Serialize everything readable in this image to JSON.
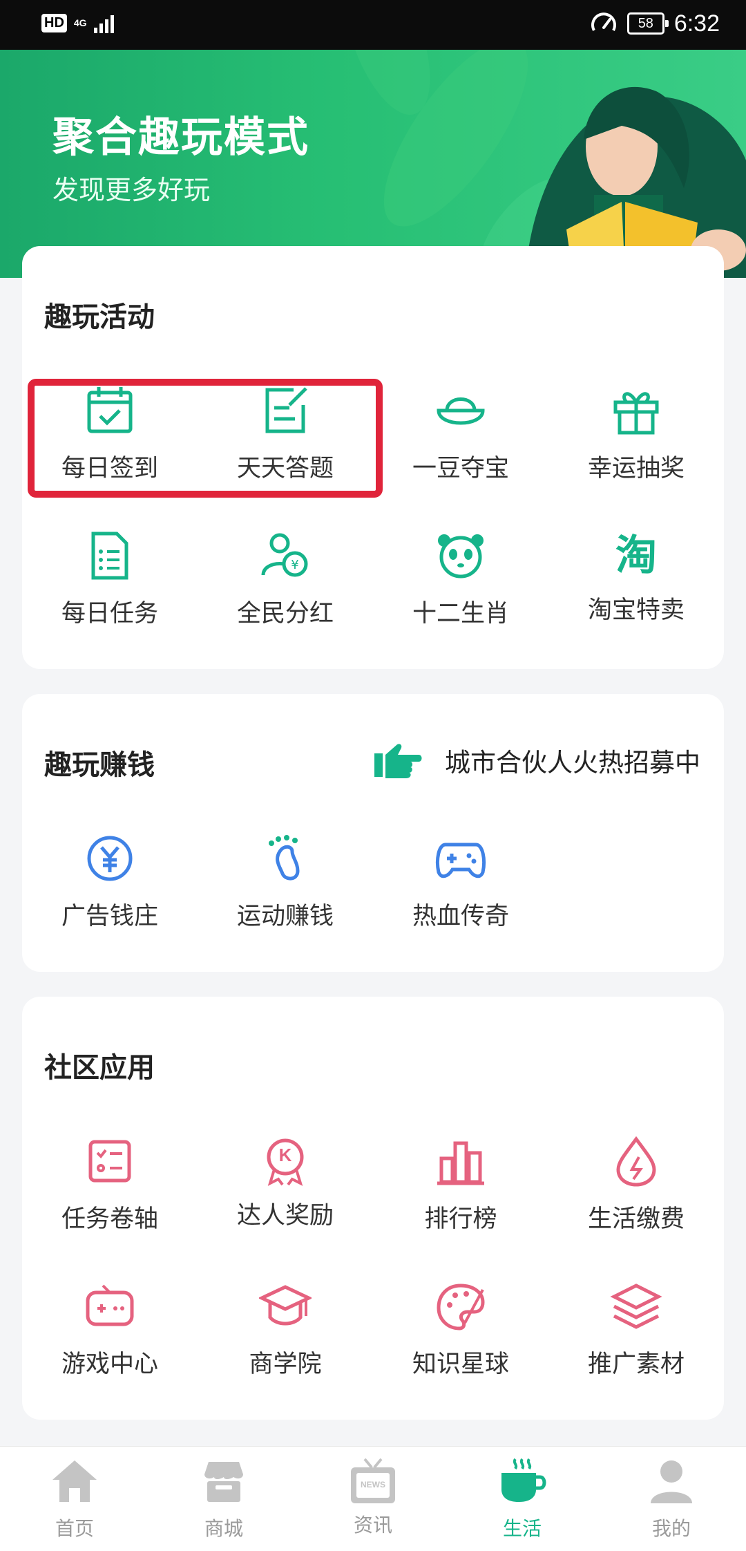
{
  "status_bar": {
    "hd": "HD",
    "network": "4G",
    "battery": "58",
    "time": "6:32"
  },
  "banner": {
    "title": "聚合趣玩模式",
    "subtitle": "发现更多好玩"
  },
  "fun_activities": {
    "title": "趣玩活动",
    "items": [
      {
        "label": "每日签到",
        "icon": "calendar-check-icon"
      },
      {
        "label": "天天答题",
        "icon": "edit-note-icon"
      },
      {
        "label": "一豆夺宝",
        "icon": "gold-ingot-icon"
      },
      {
        "label": "幸运抽奖",
        "icon": "gift-icon"
      },
      {
        "label": "每日任务",
        "icon": "task-list-icon"
      },
      {
        "label": "全民分红",
        "icon": "people-yuan-icon"
      },
      {
        "label": "十二生肖",
        "icon": "panda-icon"
      },
      {
        "label": "淘宝特卖",
        "icon": "taobao-icon",
        "glyph": "淘"
      }
    ]
  },
  "fun_earn": {
    "title": "趣玩赚钱",
    "promo": "城市合伙人火热招募中",
    "items": [
      {
        "label": "广告钱庄",
        "icon": "yuan-coin-icon"
      },
      {
        "label": "运动赚钱",
        "icon": "footprint-icon"
      },
      {
        "label": "热血传奇",
        "icon": "gamepad-icon"
      }
    ]
  },
  "community_apps": {
    "title": "社区应用",
    "items": [
      {
        "label": "任务卷轴",
        "icon": "task-scroll-icon"
      },
      {
        "label": "达人奖励",
        "icon": "medal-k-icon",
        "glyph": "K"
      },
      {
        "label": "排行榜",
        "icon": "bar-chart-icon"
      },
      {
        "label": "生活缴费",
        "icon": "utility-drop-icon"
      },
      {
        "label": "游戏中心",
        "icon": "game-console-icon"
      },
      {
        "label": "商学院",
        "icon": "graduation-cap-icon"
      },
      {
        "label": "知识星球",
        "icon": "palette-icon"
      },
      {
        "label": "推广素材",
        "icon": "layers-icon"
      }
    ]
  },
  "tab_bar": {
    "items": [
      {
        "label": "首页",
        "icon": "home-icon"
      },
      {
        "label": "商城",
        "icon": "store-icon"
      },
      {
        "label": "资讯",
        "icon": "news-tv-icon",
        "glyph": "NEWS"
      },
      {
        "label": "生活",
        "icon": "coffee-cup-icon",
        "active": true
      },
      {
        "label": "我的",
        "icon": "user-icon"
      }
    ]
  },
  "colors": {
    "brand_green": "#1fb472",
    "teal_icon": "#16b48a",
    "blue_icon": "#3f82e6",
    "pink_icon": "#e5627f",
    "highlight_red": "#e0243a"
  }
}
